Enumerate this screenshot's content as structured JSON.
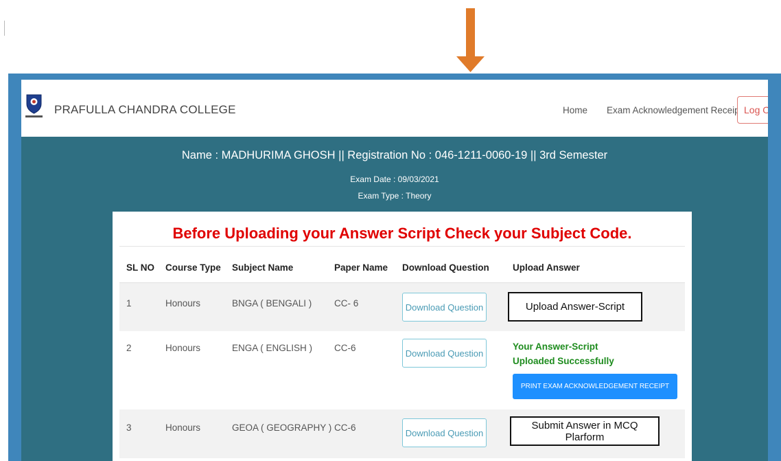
{
  "colors": {
    "frame_border": "#3f86bb",
    "banner_bg": "#2f6f82",
    "title_red": "#e00000",
    "success_green": "#1e8c1e",
    "print_button": "#1e90ff",
    "arrow": "#e07b2a",
    "logout": "#d9534f"
  },
  "icons": {
    "arrow": "down-arrow-icon",
    "logo": "college-emblem-logo"
  },
  "navbar": {
    "brand": "PRAFULLA CHANDRA COLLEGE",
    "links": [
      "Home",
      "Exam Acknowledgement Receipt"
    ],
    "logout_label": "Log O"
  },
  "student": {
    "info_line": "Name : MADHURIMA GHOSH || Registration No : 046-1211-0060-19 || 3rd Semester",
    "exam_date": "Exam Date : 09/03/2021",
    "exam_type": "Exam Type : Theory"
  },
  "notice": "Before Uploading your Answer Script Check your Subject Code.",
  "table": {
    "headers": [
      "SL NO",
      "Course Type",
      "Subject Name",
      "Paper Name",
      "Download Question",
      "Upload Answer"
    ],
    "rows": [
      {
        "sl": "1",
        "course": "Honours",
        "subject": "BNGA ( BENGALI )",
        "paper": "CC- 6",
        "download": "Download Question",
        "action": "Upload Answer-Script"
      },
      {
        "sl": "2",
        "course": "Honours",
        "subject": "ENGA ( ENGLISH )",
        "paper": "CC-6",
        "download": "Download Question",
        "status_line1": "Your Answer-Script",
        "status_line2": "Uploaded Successfully",
        "print_label": "PRINT EXAM ACKNOWLEDGEMENT RECEIPT"
      },
      {
        "sl": "3",
        "course": "Honours",
        "subject": "GEOA ( GEOGRAPHY )",
        "paper": "CC-6",
        "download": "Download Question",
        "action": "Submit Answer in MCQ Plarform"
      }
    ]
  }
}
